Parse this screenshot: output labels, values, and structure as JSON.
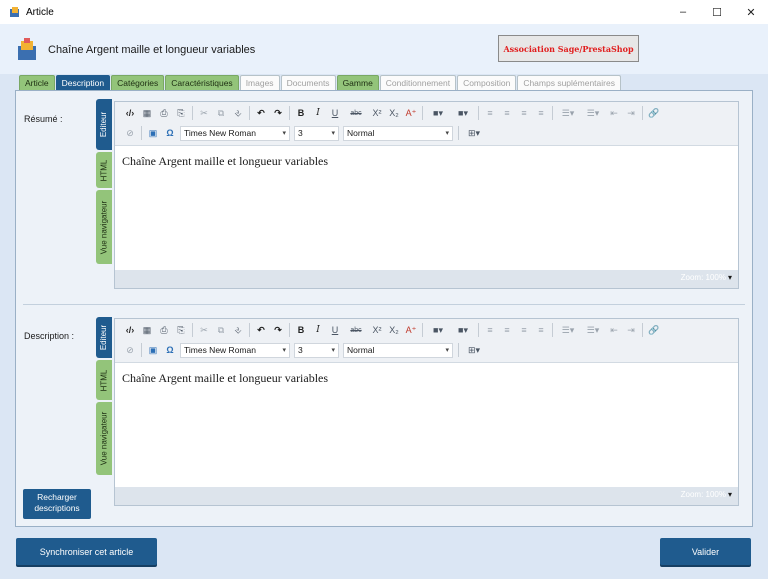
{
  "window": {
    "title": "Article",
    "controls": {
      "minimize": "–",
      "maximize": "☐",
      "close": "✕"
    }
  },
  "header": {
    "product_title": "Chaîne Argent maille et longueur variables",
    "association_button": "Association Sage/PrestaShop"
  },
  "tabs": [
    {
      "label": "Article",
      "state": "green"
    },
    {
      "label": "Description",
      "state": "active"
    },
    {
      "label": "Catégories",
      "state": "green"
    },
    {
      "label": "Caractéristiques",
      "state": "green"
    },
    {
      "label": "Images",
      "state": "disabled"
    },
    {
      "label": "Documents",
      "state": "disabled"
    },
    {
      "label": "Gamme",
      "state": "green"
    },
    {
      "label": "Conditionnement",
      "state": "disabled"
    },
    {
      "label": "Composition",
      "state": "disabled"
    },
    {
      "label": "Champs suplémentaires",
      "state": "disabled"
    }
  ],
  "resume": {
    "label": "Résumé :",
    "vtabs": {
      "editor": "Editeur",
      "html": "HTML",
      "preview": "Vue navigateur"
    },
    "font": "Times New Roman",
    "size": "3",
    "format": "Normal",
    "content": "Chaîne Argent maille et longueur variables",
    "zoom": "Zoom: 100%"
  },
  "description": {
    "label": "Description :",
    "vtabs": {
      "editor": "Editeur",
      "html": "HTML",
      "preview": "Vue navigateur"
    },
    "font": "Times New Roman",
    "size": "3",
    "format": "Normal",
    "content": "Chaîne Argent maille et longueur variables",
    "zoom": "Zoom: 100%"
  },
  "toolbar_glyphs": {
    "source": "‹/›",
    "template": "▦",
    "print": "⎙",
    "preview": "⎘",
    "cut": "✂",
    "copy": "⧉",
    "paste": "⎀",
    "undo": "↶",
    "redo": "↷",
    "bold": "B",
    "italic": "I",
    "underline": "U",
    "strike": "abc",
    "superscript": "X²",
    "subscript": "X₂",
    "clear_format": "A⁺",
    "forecolor": "■▾",
    "backcolor": "■▾",
    "align_left": "≡",
    "align_center": "≡",
    "align_right": "≡",
    "justify": "≡",
    "ordered_list": "☰▾",
    "unordered_list": "☰▾",
    "outdent": "⇤",
    "indent": "⇥",
    "link": "🔗",
    "unlink": "⊘",
    "image": "▣",
    "special_char": "Ω",
    "dropdown_arrow": "▾",
    "table": "⊞▾"
  },
  "buttons": {
    "reload_line1": "Recharger",
    "reload_line2": "descriptions",
    "sync": "Synchroniser cet article",
    "validate": "Valider"
  },
  "colors": {
    "accent": "#1f5b8e",
    "tab_green": "#93c47a",
    "association_text": "#e11d1d"
  }
}
